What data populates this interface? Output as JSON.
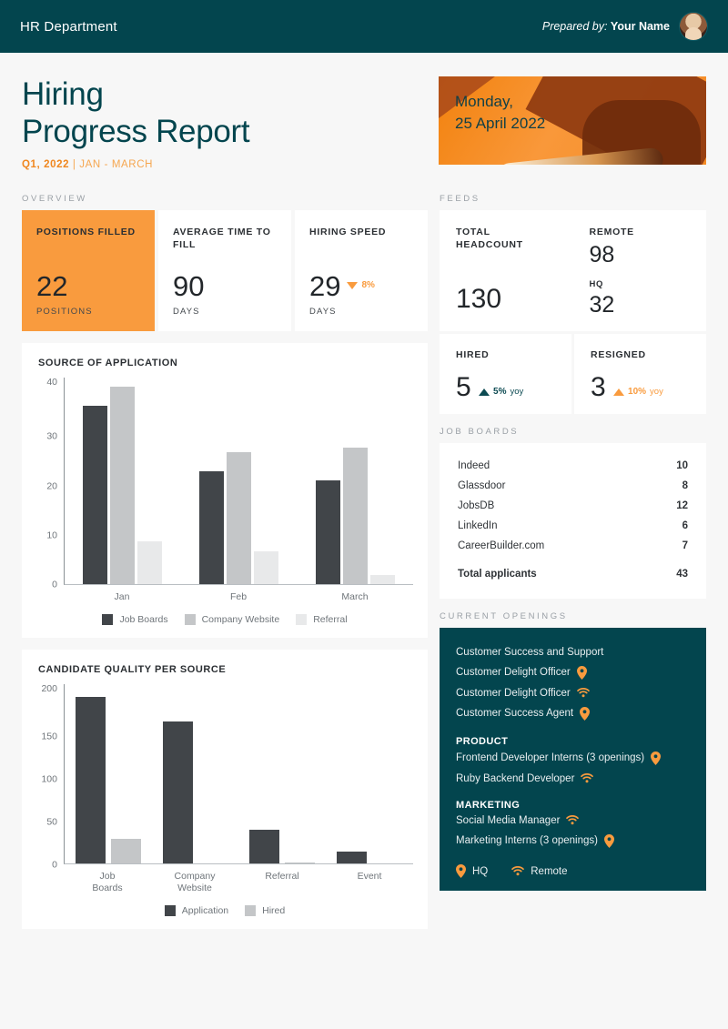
{
  "topbar": {
    "title": "HR Department",
    "prepared_prefix": "Prepared by:",
    "prepared_name": "Your Name"
  },
  "hero": {
    "title_line1": "Hiring",
    "title_line2": "Progress Report",
    "quarter": "Q1, 2022",
    "range": "| JAN - MARCH",
    "date_line1": "Monday,",
    "date_line2": "25 April 2022"
  },
  "sections": {
    "overview": "Overview",
    "feeds": "Feeds",
    "job_boards": "Job Boards",
    "current_openings": "Current Openings"
  },
  "kpis": [
    {
      "title": "POSITIONS FILLED",
      "value": "22",
      "unit": "POSITIONS"
    },
    {
      "title": "AVERAGE TIME TO FILL",
      "value": "90",
      "unit": "DAYS"
    },
    {
      "title": "HIRING SPEED",
      "value": "29",
      "unit": "DAYS",
      "delta": "8%",
      "delta_dir": "down"
    }
  ],
  "feeds": {
    "total_headcount_label": "TOTAL HEADCOUNT",
    "total_headcount_value": "130",
    "remote_label": "REMOTE",
    "remote_value": "98",
    "hq_label": "HQ",
    "hq_value": "32",
    "hired_label": "HIRED",
    "hired_value": "5",
    "hired_delta": "5%",
    "hired_yoy": "yoy",
    "resigned_label": "RESIGNED",
    "resigned_value": "3",
    "resigned_delta": "10%",
    "resigned_yoy": "yoy"
  },
  "job_boards": {
    "rows": [
      {
        "name": "Indeed",
        "value": "10"
      },
      {
        "name": "Glassdoor",
        "value": "8"
      },
      {
        "name": "JobsDB",
        "value": "12"
      },
      {
        "name": "LinkedIn",
        "value": "6"
      },
      {
        "name": "CareerBuilder.com",
        "value": "7"
      }
    ],
    "total_label": "Total applicants",
    "total_value": "43"
  },
  "openings": {
    "items": [
      {
        "label": "Customer Success and Support",
        "icon": "none"
      },
      {
        "label": "Customer Delight Officer",
        "icon": "pin"
      },
      {
        "label": "Customer Delight Officer",
        "icon": "wifi"
      },
      {
        "label": "Customer Success Agent",
        "icon": "pin"
      }
    ],
    "product_head": "PRODUCT",
    "product_items": [
      {
        "label": "Frontend Developer Interns (3 openings)",
        "icon": "pin"
      },
      {
        "label": "Ruby Backend Developer",
        "icon": "wifi"
      }
    ],
    "marketing_head": "MARKETING",
    "marketing_items": [
      {
        "label": "Social Media Manager",
        "icon": "wifi"
      },
      {
        "label": "Marketing Interns (3 openings)",
        "icon": "pin"
      }
    ],
    "legend_hq": "HQ",
    "legend_remote": "Remote"
  },
  "colors": {
    "teal": "#03454e",
    "orange": "#f99b3e",
    "bar_dark": "#414549",
    "bar_mid": "#c4c6c8",
    "bar_light": "#e8e9ea",
    "page_bg": "#f7f7f7"
  },
  "chart_data": [
    {
      "type": "bar",
      "title": "SOURCE OF APPLICATION",
      "categories": [
        "Jan",
        "Feb",
        "March"
      ],
      "series": [
        {
          "name": "Job Boards",
          "values": [
            38,
            24,
            22
          ],
          "color": "#414549"
        },
        {
          "name": "Company Website",
          "values": [
            42,
            28,
            29
          ],
          "color": "#c4c6c8"
        },
        {
          "name": "Referral",
          "values": [
            9,
            7,
            2
          ],
          "color": "#e8e9ea"
        }
      ],
      "yticks": [
        0,
        10,
        20,
        30,
        40
      ],
      "ylim": [
        0,
        44
      ],
      "xlabel": "",
      "ylabel": "",
      "grid": false,
      "legend_position": "bottom"
    },
    {
      "type": "bar",
      "title": "CANDIDATE QUALITY PER SOURCE",
      "categories": [
        "Job Boards",
        "Company Website",
        "Referral",
        "Event"
      ],
      "series": [
        {
          "name": "Application",
          "values": [
            200,
            170,
            40,
            14
          ],
          "color": "#414549"
        },
        {
          "name": "Hired",
          "values": [
            30,
            0,
            1,
            0
          ],
          "color": "#c4c6c8"
        }
      ],
      "yticks": [
        0,
        50,
        100,
        150,
        200
      ],
      "ylim": [
        0,
        215
      ],
      "xlabel": "",
      "ylabel": "",
      "grid": false,
      "legend_position": "bottom"
    }
  ]
}
